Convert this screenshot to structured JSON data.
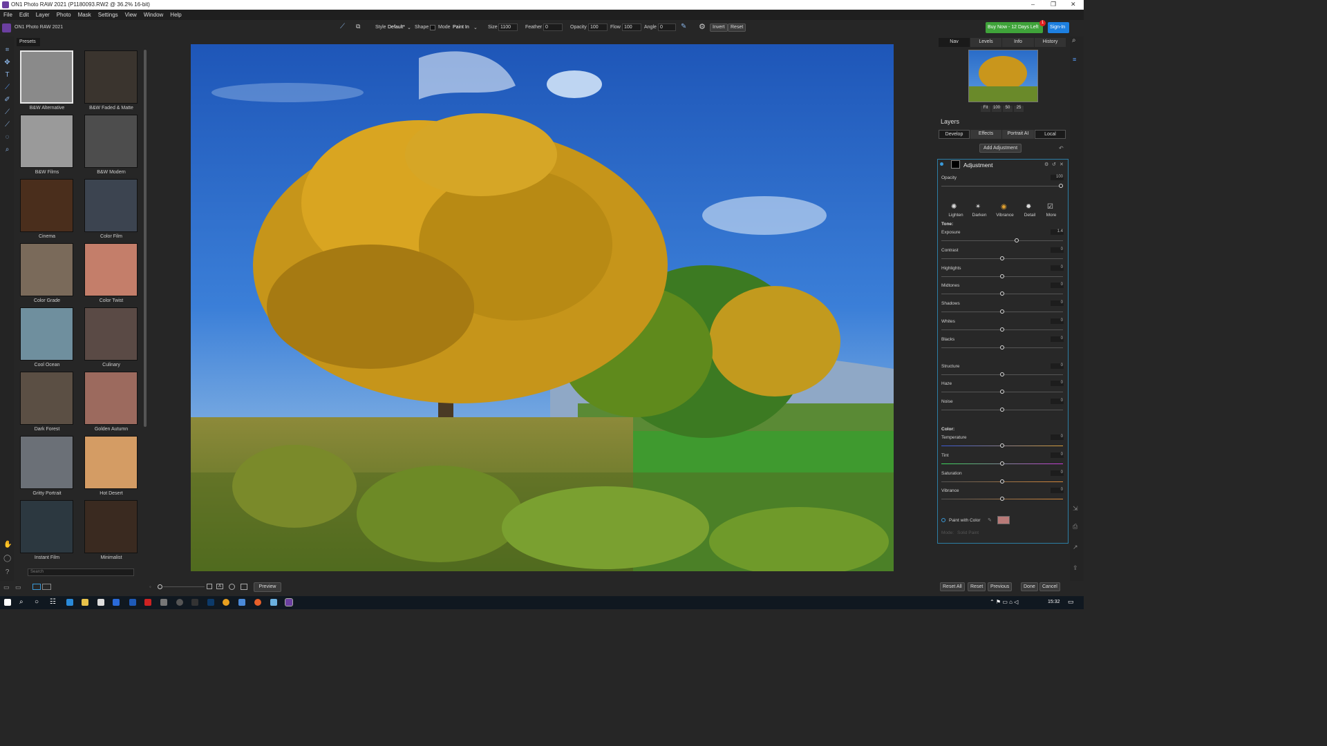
{
  "window": {
    "title": "ON1 Photo RAW 2021 (P1180093.RW2 @ 36.2% 16-bit)"
  },
  "menu": [
    "File",
    "Edit",
    "Layer",
    "Photo",
    "Mask",
    "Settings",
    "View",
    "Window",
    "Help"
  ],
  "app": {
    "name": "ON1 Photo RAW 2021"
  },
  "toolbar": {
    "style_label": "Style",
    "style_value": "Default*",
    "shape_label": "Shape",
    "mode_label": "Mode",
    "mode_value": "Paint In",
    "size_label": "Size",
    "size_value": "1100",
    "feather_label": "Feather",
    "feather_value": "0",
    "opacity_label": "Opacity",
    "opacity_value": "100",
    "flow_label": "Flow",
    "flow_value": "100",
    "angle_label": "Angle",
    "angle_value": "0",
    "invert_label": "Invert",
    "reset_label": "Reset",
    "buy_label": "Buy Now - 12 Days Left",
    "buy_badge": "1",
    "signin_label": "Sign-In"
  },
  "presets": {
    "tab_label": "Presets",
    "search_placeholder": "Search",
    "items": [
      {
        "label": "B&W Alternative",
        "color": "#8a8a8a",
        "selected": true
      },
      {
        "label": "B&W Faded & Matte",
        "color": "#3a342e"
      },
      {
        "label": "B&W Films",
        "color": "#9a9a9a"
      },
      {
        "label": "B&W Modern",
        "color": "#4d4d4d"
      },
      {
        "label": "Cinema",
        "color": "#4a2e1c"
      },
      {
        "label": "Color Film",
        "color": "#3c4450"
      },
      {
        "label": "Color Grade",
        "color": "#7a6a5a"
      },
      {
        "label": "Color Twist",
        "color": "#c47e6a"
      },
      {
        "label": "Cool Ocean",
        "color": "#6f8f9e"
      },
      {
        "label": "Culinary",
        "color": "#5a4a45"
      },
      {
        "label": "Dark Forest",
        "color": "#5b4f44"
      },
      {
        "label": "Golden Autumn",
        "color": "#9c6a5e"
      },
      {
        "label": "Gritty Portrait",
        "color": "#6b7077"
      },
      {
        "label": "Hot Desert",
        "color": "#d49c64"
      },
      {
        "label": "Instant Film",
        "color": "#2c3840"
      },
      {
        "label": "Minimalist",
        "color": "#3a2a20"
      }
    ]
  },
  "nav_tabs": [
    "Nav",
    "Levels",
    "Info",
    "History"
  ],
  "zoom_buttons": [
    "Fit",
    "100",
    "50",
    "25"
  ],
  "layers": {
    "title": "Layers",
    "tabs": [
      "Develop",
      "Effects",
      "Portrait AI",
      "Local"
    ],
    "add_adjustment": "Add Adjustment"
  },
  "adjustment": {
    "title": "Adjustment",
    "opacity_label": "Opacity",
    "opacity_value": "100",
    "quick_buttons": [
      "Lighten",
      "Darken",
      "Vibrance",
      "Detail",
      "More"
    ],
    "tone_label": "Tone:",
    "color_label": "Color:",
    "sliders": [
      {
        "label": "Exposure",
        "value": "1.4"
      },
      {
        "label": "Contrast",
        "value": "0"
      },
      {
        "label": "Highlights",
        "value": "0"
      },
      {
        "label": "Midtones",
        "value": "0"
      },
      {
        "label": "Shadows",
        "value": "0"
      },
      {
        "label": "Whites",
        "value": "0"
      },
      {
        "label": "Blacks",
        "value": "0"
      },
      {
        "label": "Structure",
        "value": "0"
      },
      {
        "label": "Haze",
        "value": "0"
      },
      {
        "label": "Noise",
        "value": "0"
      },
      {
        "label": "Temperature",
        "value": "0"
      },
      {
        "label": "Tint",
        "value": "0"
      },
      {
        "label": "Saturation",
        "value": "0"
      },
      {
        "label": "Vibrance",
        "value": "0"
      }
    ],
    "paint_with_color": "Paint with Color",
    "paint_color": "#b87a78",
    "mode_label": "Mode:",
    "mode_value": "Solid Paint"
  },
  "bottom": {
    "preview_label": "Preview",
    "reset_all": "Reset All",
    "reset": "Reset",
    "previous": "Previous",
    "done": "Done",
    "cancel": "Cancel"
  },
  "taskbar": {
    "time": "15:32"
  }
}
